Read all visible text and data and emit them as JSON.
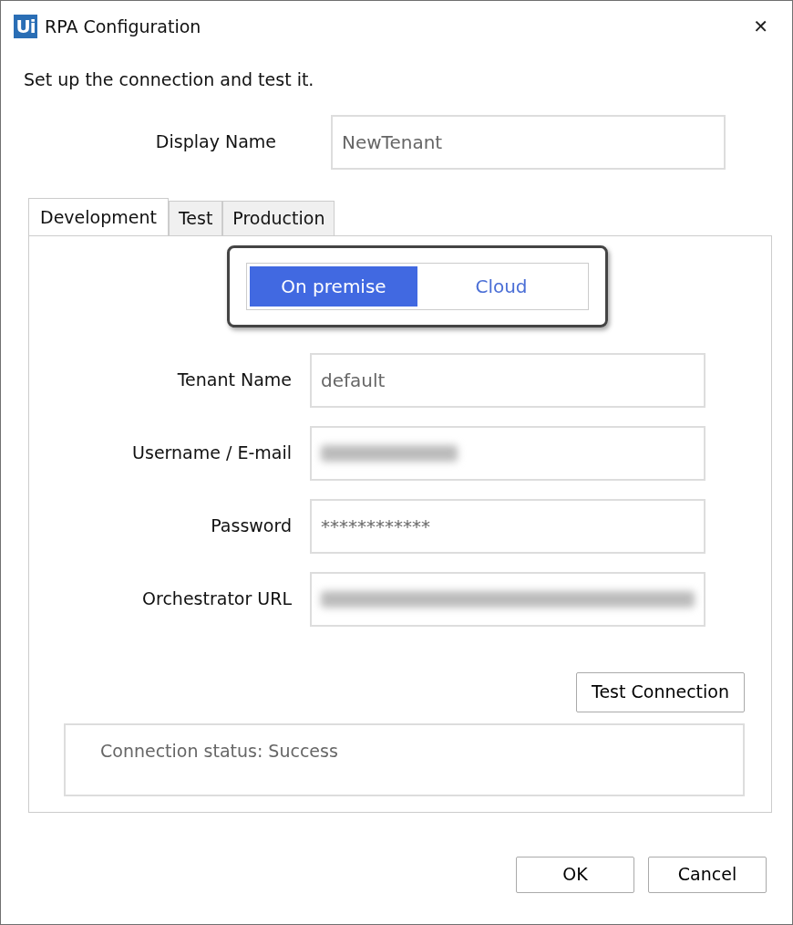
{
  "window": {
    "logo_text": "Ui",
    "title": "RPA Configuration",
    "close": "✕"
  },
  "intro": "Set up the connection and test it.",
  "display_name": {
    "label": "Display Name",
    "value": "NewTenant"
  },
  "tabs": [
    {
      "label": "Development",
      "selected": true
    },
    {
      "label": "Test",
      "selected": false
    },
    {
      "label": "Production",
      "selected": false
    }
  ],
  "mode_toggle": [
    {
      "label": "On premise",
      "selected": true
    },
    {
      "label": "Cloud",
      "selected": false
    }
  ],
  "fields": [
    {
      "label": "Tenant Name",
      "value": "default",
      "redacted": false
    },
    {
      "label": "Username / E-mail",
      "redacted": true
    },
    {
      "label": "Password",
      "value": "************",
      "redacted": false
    },
    {
      "label": "Orchestrator URL",
      "redacted": true
    }
  ],
  "test_button": "Test Connection",
  "status": "Connection status: Success",
  "buttons": [
    "OK",
    "Cancel"
  ]
}
